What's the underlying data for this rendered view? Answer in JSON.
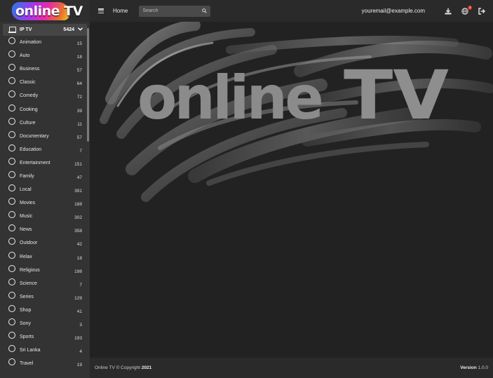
{
  "brand": {
    "name": "online TV"
  },
  "sidebar": {
    "root": {
      "label": "IP TV",
      "count": "5424"
    },
    "categories": [
      {
        "label": "Animation",
        "count": "15"
      },
      {
        "label": "Auto",
        "count": "18"
      },
      {
        "label": "Business",
        "count": "57"
      },
      {
        "label": "Classic",
        "count": "64"
      },
      {
        "label": "Comedy",
        "count": "72"
      },
      {
        "label": "Cooking",
        "count": "39"
      },
      {
        "label": "Culture",
        "count": "11"
      },
      {
        "label": "Documentary",
        "count": "57"
      },
      {
        "label": "Education",
        "count": "7"
      },
      {
        "label": "Entertainment",
        "count": "151"
      },
      {
        "label": "Family",
        "count": "47"
      },
      {
        "label": "Local",
        "count": "391"
      },
      {
        "label": "Movies",
        "count": "188"
      },
      {
        "label": "Music",
        "count": "302"
      },
      {
        "label": "News",
        "count": "358"
      },
      {
        "label": "Outdoor",
        "count": "42"
      },
      {
        "label": "Relax",
        "count": "18"
      },
      {
        "label": "Religious",
        "count": "198"
      },
      {
        "label": "Science",
        "count": "7"
      },
      {
        "label": "Series",
        "count": "129"
      },
      {
        "label": "Shop",
        "count": "41"
      },
      {
        "label": "Sony",
        "count": "3"
      },
      {
        "label": "Sports",
        "count": "193"
      },
      {
        "label": "Sri Lanka",
        "count": "4"
      },
      {
        "label": "Travel",
        "count": "19"
      }
    ]
  },
  "topbar": {
    "home_label": "Home",
    "search_placeholder": "Search",
    "user_email": "youremail@example.com",
    "notification_count": "3"
  },
  "hero": {
    "text_online": "online",
    "text_tv": "TV"
  },
  "footer": {
    "copyright_prefix": "Online TV © Copyright",
    "year": "2021",
    "version_label": "Version",
    "version_value": "1.0.0"
  },
  "colors": {
    "accent_badge": "#d9342b",
    "sidebar_bg": "#333333",
    "main_bg": "#222222"
  },
  "icons": [
    "laptop-icon",
    "chevron-down-icon",
    "radio-circle-icon",
    "menu-icon",
    "search-icon",
    "download-icon",
    "globe-icon",
    "logout-icon"
  ]
}
